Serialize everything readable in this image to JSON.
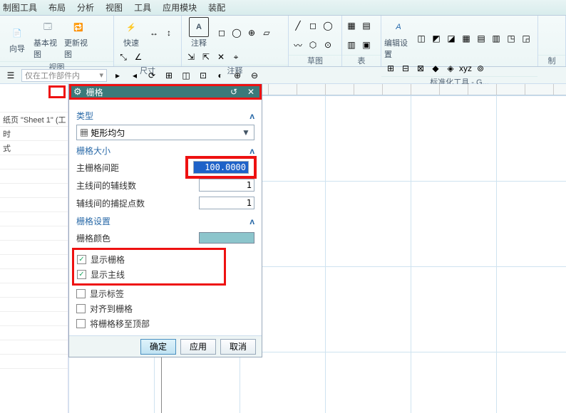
{
  "menu": {
    "items": [
      "制图工具",
      "布局",
      "分析",
      "视图",
      "工具",
      "应用模块",
      "装配"
    ]
  },
  "ribbon": {
    "groups": [
      {
        "label": "视图",
        "big": [
          {
            "name": "导",
            "label": "向导"
          },
          {
            "name": "基本视图",
            "label": "基本视图"
          },
          {
            "name": "更新视图",
            "label": "更新视图"
          }
        ]
      },
      {
        "label": "尺寸",
        "big": [
          {
            "name": "快速",
            "label": "快速"
          }
        ]
      },
      {
        "label": "注释",
        "big": [
          {
            "name": "注释",
            "label": "注释"
          }
        ]
      },
      {
        "label": "草图",
        "big": []
      },
      {
        "label": "表",
        "big": []
      },
      {
        "label": "标准化工具 - G...",
        "big": [
          {
            "name": "编辑设置",
            "label": "编辑设置"
          }
        ]
      },
      {
        "label": "制",
        "big": []
      }
    ]
  },
  "quickbar": {
    "combo": "仅在工作部件内"
  },
  "leftpanel": {
    "rows": [
      "纸页 \"Sheet 1\" (工",
      "时",
      "式",
      "",
      "",
      "",
      "",
      "",
      "",
      "",
      "",
      "",
      "",
      "",
      "",
      "",
      "",
      "",
      "",
      ""
    ]
  },
  "dialog": {
    "title": "栅格",
    "type_section": "类型",
    "type_value": "矩形均匀",
    "size_section": "栅格大小",
    "fields": [
      {
        "label": "主栅格间距",
        "value": "100.0000",
        "hl": true
      },
      {
        "label": "主线间的辅线数",
        "value": "1",
        "hl": false
      },
      {
        "label": "辅线间的捕捉点数",
        "value": "1",
        "hl": false
      }
    ],
    "settings_section": "栅格设置",
    "color_label": "栅格颜色",
    "checks_hl": [
      {
        "label": "显示栅格",
        "checked": true
      },
      {
        "label": "显示主线",
        "checked": true
      }
    ],
    "checks": [
      {
        "label": "显示标签",
        "checked": false
      },
      {
        "label": "对齐到栅格",
        "checked": false
      },
      {
        "label": "将栅格移至顶部",
        "checked": false
      }
    ],
    "buttons": {
      "ok": "确定",
      "apply": "应用",
      "cancel": "取消"
    }
  }
}
